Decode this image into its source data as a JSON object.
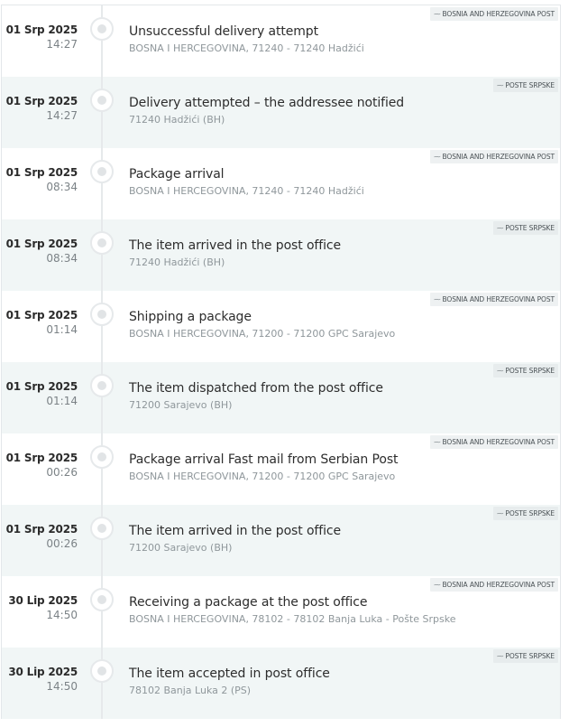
{
  "events": [
    {
      "date": "01 Srp 2025",
      "time": "14:27",
      "title": "Unsuccessful delivery attempt",
      "location": "BOSNA I HERCEGOVINA, 71240 - 71240 Hadžići",
      "source": "BOSNIA AND HERZEGOVINA POST",
      "shaded": false
    },
    {
      "date": "01 Srp 2025",
      "time": "14:27",
      "title": "Delivery attempted – the addressee notified",
      "location": "71240 Hadžići (BH)",
      "source": "POSTE SRPSKE",
      "shaded": true
    },
    {
      "date": "01 Srp 2025",
      "time": "08:34",
      "title": "Package arrival",
      "location": "BOSNA I HERCEGOVINA, 71240 - 71240 Hadžići",
      "source": "BOSNIA AND HERZEGOVINA POST",
      "shaded": false
    },
    {
      "date": "01 Srp 2025",
      "time": "08:34",
      "title": "The item arrived in the post office",
      "location": "71240 Hadžići (BH)",
      "source": "POSTE SRPSKE",
      "shaded": true
    },
    {
      "date": "01 Srp 2025",
      "time": "01:14",
      "title": "Shipping a package",
      "location": "BOSNA I HERCEGOVINA, 71200 - 71200 GPC Sarajevo",
      "source": "BOSNIA AND HERZEGOVINA POST",
      "shaded": false
    },
    {
      "date": "01 Srp 2025",
      "time": "01:14",
      "title": "The item dispatched from the post office",
      "location": "71200 Sarajevo (BH)",
      "source": "POSTE SRPSKE",
      "shaded": true
    },
    {
      "date": "01 Srp 2025",
      "time": "00:26",
      "title": "Package arrival Fast mail from Serbian Post",
      "location": "BOSNA I HERCEGOVINA, 71200 - 71200 GPC Sarajevo",
      "source": "BOSNIA AND HERZEGOVINA POST",
      "shaded": false
    },
    {
      "date": "01 Srp 2025",
      "time": "00:26",
      "title": "The item arrived in the post office",
      "location": "71200 Sarajevo (BH)",
      "source": "POSTE SRPSKE",
      "shaded": true
    },
    {
      "date": "30 Lip 2025",
      "time": "14:50",
      "title": "Receiving a package at the post office",
      "location": "BOSNA I HERCEGOVINA, 78102 - 78102 Banja Luka - Pošte Srpske",
      "source": "BOSNIA AND HERZEGOVINA POST",
      "shaded": false
    },
    {
      "date": "30 Lip 2025",
      "time": "14:50",
      "title": "The item accepted in post office",
      "location": "78102 Banja Luka 2 (PS)",
      "source": "POSTE SRPSKE",
      "shaded": true
    }
  ],
  "icons": {
    "source_tag": "transit-line-icon"
  },
  "colors": {
    "shaded_row": "#f1f6f6",
    "timeline_line": "#e6e9eb"
  }
}
